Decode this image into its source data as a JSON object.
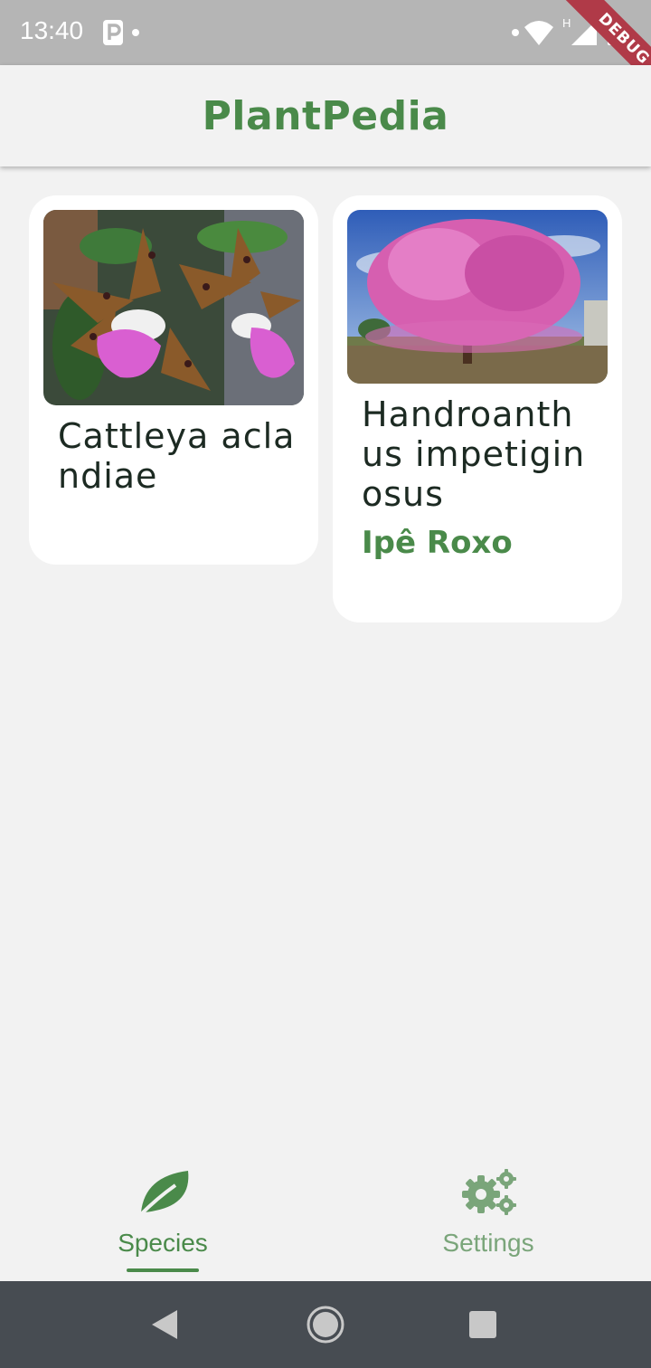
{
  "status_bar": {
    "time": "13:40",
    "network_label": "H",
    "debug_banner": "DEBUG"
  },
  "app_bar": {
    "title": "PlantPedia"
  },
  "species": [
    {
      "scientific_name": "Cattleya aclandiae",
      "common_name": "",
      "image": "orchid-photo"
    },
    {
      "scientific_name": "Handroanthus impetiginosus",
      "common_name": "Ipê Roxo",
      "image": "pink-tree-photo"
    }
  ],
  "bottom_nav": {
    "items": [
      {
        "label": "Species",
        "icon": "leaf-icon",
        "selected": true
      },
      {
        "label": "Settings",
        "icon": "gears-icon",
        "selected": false
      }
    ]
  },
  "colors": {
    "accent": "#4a8a4a",
    "text_dark": "#1c2a22",
    "background": "#f2f2f2",
    "system_nav": "#474c52"
  }
}
